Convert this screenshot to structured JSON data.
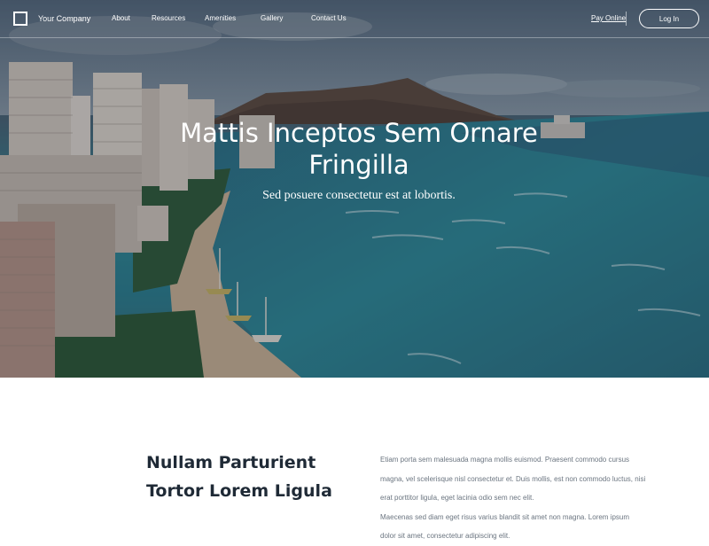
{
  "nav": {
    "brand": "Your Company",
    "links": [
      "About",
      "Resources",
      "Amenities",
      "Gallery",
      "Contact Us"
    ],
    "pay_online": "Pay Online",
    "login": "Log In"
  },
  "hero": {
    "title": "Mattis Inceptos Sem Ornare Fringilla",
    "subtitle": "Sed posuere consectetur est at lobortis."
  },
  "section": {
    "heading": "Nullam Parturient Tortor Lorem Ligula",
    "paragraphs": [
      "Etiam porta sem malesuada magna mollis euismod. Praesent commodo cursus magna, vel scelerisque nisl consectetur et. Duis mollis, est non commodo luctus, nisi erat porttitor ligula, eget lacinia odio sem nec elit.",
      "Maecenas sed diam eget risus varius blandit sit amet non magna. Lorem ipsum dolor sit amet, consectetur adipiscing elit."
    ]
  },
  "colors": {
    "heading": "#1f2a36",
    "body_text": "#6b7580",
    "nav_text": "#ffffff"
  },
  "icons": {
    "logo": "square-outline-logo-icon"
  }
}
